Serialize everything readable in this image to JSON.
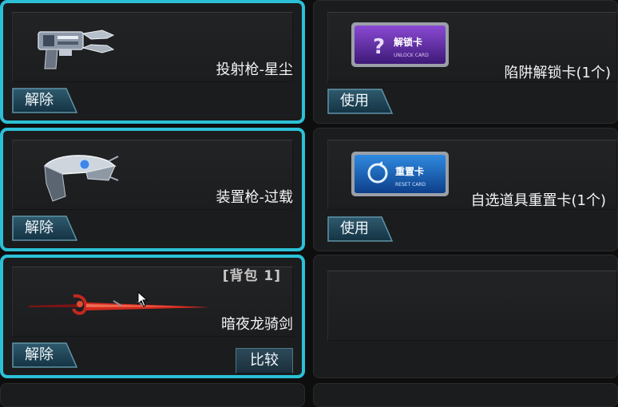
{
  "slots": [
    {
      "name": "投射枪-星尘",
      "button": "解除",
      "selected": true,
      "icon": "projectile-gun-icon"
    },
    {
      "name": "陷阱解锁卡(1个)",
      "button": "使用",
      "selected": false,
      "icon": "unlock-card-icon",
      "card_title": "解锁卡",
      "card_sub": "UNLOCK CARD"
    },
    {
      "name": "装置枪-过载",
      "button": "解除",
      "selected": true,
      "icon": "device-gun-icon"
    },
    {
      "name": "自选道具重置卡(1个)",
      "button": "使用",
      "selected": false,
      "icon": "reset-card-icon",
      "card_title": "重置卡",
      "card_sub": "RESET CARD"
    },
    {
      "name": "暗夜龙骑剑",
      "button": "解除",
      "selected": true,
      "icon": "red-sword-icon",
      "compare": "比较",
      "backpack": "[背包 1]"
    },
    {
      "name": "",
      "button": "",
      "selected": false
    }
  ],
  "colors": {
    "selected_border": "#2cc0d6",
    "background": "#0e0e0f",
    "slot": "#1b1c1d"
  }
}
